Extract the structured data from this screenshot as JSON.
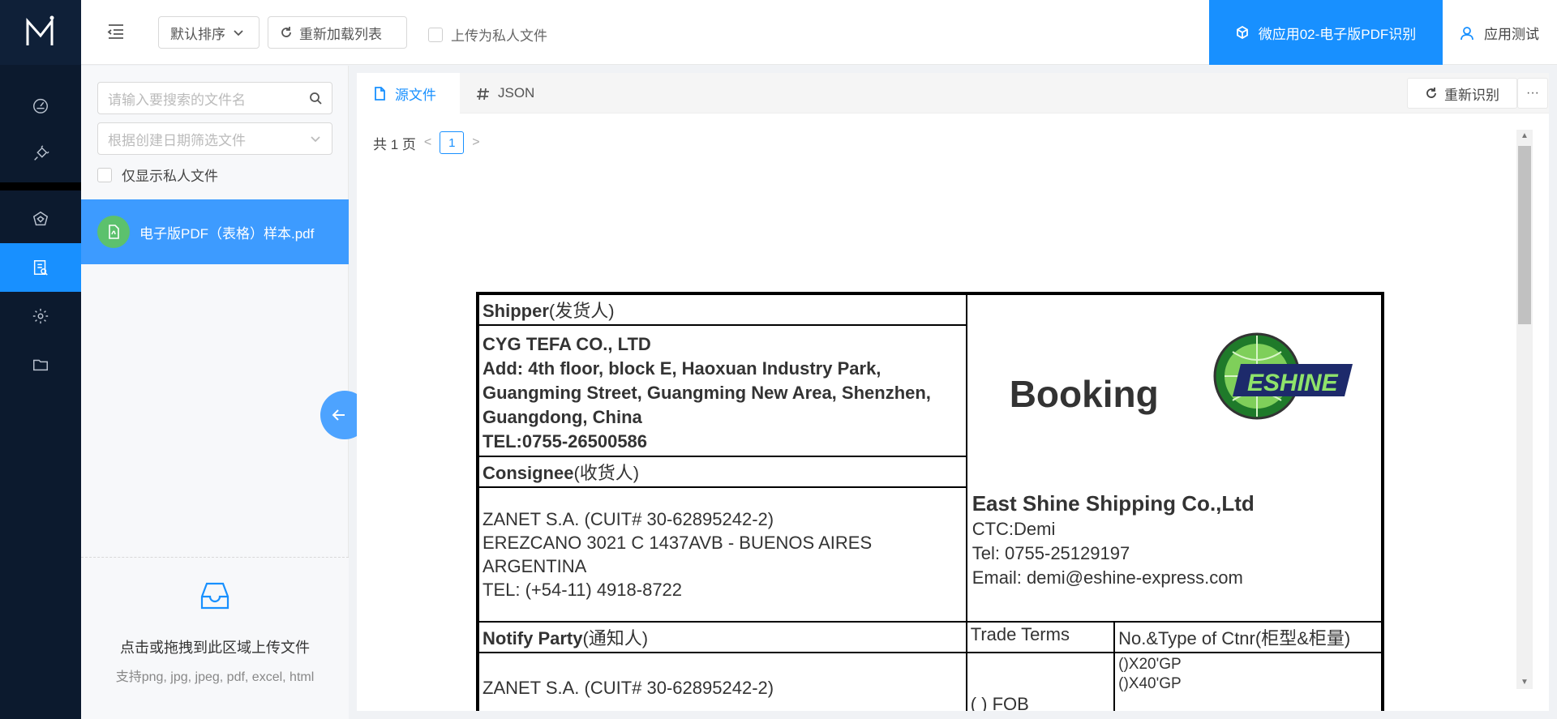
{
  "topbar": {
    "sort_label": "默认排序",
    "reload_label": "重新加载列表",
    "private_upload_label": "上传为私人文件",
    "app_name": "微应用02-电子版PDF识别",
    "user_name": "应用测试"
  },
  "filepanel": {
    "search_placeholder": "请输入要搜索的文件名",
    "date_placeholder": "根据创建日期筛选文件",
    "only_private_label": "仅显示私人文件",
    "files": [
      {
        "name": "电子版PDF（表格）样本.pdf"
      }
    ],
    "upload_title": "点击或拖拽到此区域上传文件",
    "upload_hint": "支持png, jpg, jpeg, pdf, excel, html"
  },
  "main": {
    "tab_source": "源文件",
    "tab_json": "JSON",
    "recognize_label": "重新识别",
    "more_label": "···",
    "pager": {
      "total_text": "共 1 页",
      "current": "1",
      "prev": "<",
      "next": ">"
    }
  },
  "doc": {
    "shipper_header": "Shipper",
    "shipper_header_cn": "(发货人)",
    "shipper_lines": [
      "CYG TEFA CO., LTD",
      "Add: 4th floor, block E, Haoxuan Industry Park,",
      "Guangming Street, Guangming New Area, Shenzhen,",
      "Guangdong, China",
      "TEL:0755-26500586"
    ],
    "consignee_header": "Consignee",
    "consignee_header_cn": "(收货人)",
    "consignee_lines": [
      "ZANET S.A. (CUIT# 30-62895242-2)",
      "EREZCANO 3021  C 1437AVB - BUENOS AIRES",
      "ARGENTINA",
      "TEL: (+54-11) 4918-8722"
    ],
    "booking_title": "Booking",
    "logo_text": "ESHINE",
    "company_name": "East Shine Shipping Co.,Ltd",
    "company_lines": [
      "CTC:Demi",
      "Tel: 0755-25129197",
      "Email: demi@eshine-express.com"
    ],
    "notify_header": "Notify Party",
    "notify_header_cn": "(通知人)",
    "trade_terms_header": "Trade Terms",
    "ctnr_header": "No.&Type of Ctnr",
    "ctnr_header_cn": "(柜型&柜量)",
    "notify_line": "ZANET S.A. (CUIT# 30-62895242-2)",
    "trade_terms_value": "( ) FOB",
    "ctnr_lines": [
      "()X20'GP",
      "()X40'GP"
    ]
  },
  "colors": {
    "accent": "#1890ff",
    "nav_bg": "#0c1a2e",
    "file_selected": "#3d9bff",
    "file_icon": "#5cc16d"
  }
}
